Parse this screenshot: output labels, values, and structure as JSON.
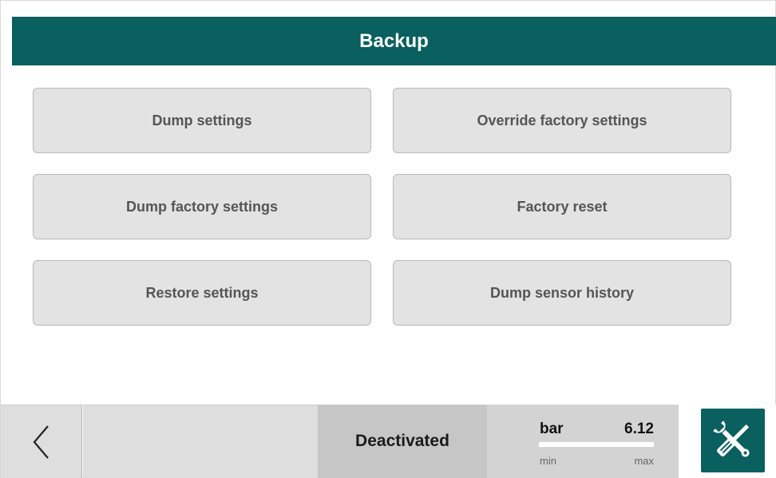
{
  "header": {
    "title": "Backup"
  },
  "buttons": [
    {
      "label": "Dump settings"
    },
    {
      "label": "Override factory settings"
    },
    {
      "label": "Dump factory settings"
    },
    {
      "label": "Factory reset"
    },
    {
      "label": "Restore settings"
    },
    {
      "label": "Dump sensor history"
    }
  ],
  "footer": {
    "back_icon": "chevron-left-icon",
    "status": "Deactivated",
    "gauge": {
      "unit": "bar",
      "value": "6.12",
      "min_label": "min",
      "max_label": "max",
      "level": 1.0
    },
    "tools_icon": "wrench-screwdriver-icon"
  },
  "colors": {
    "accent": "#0a5f5f",
    "button_bg": "#e3e3e3",
    "button_text": "#555555"
  }
}
